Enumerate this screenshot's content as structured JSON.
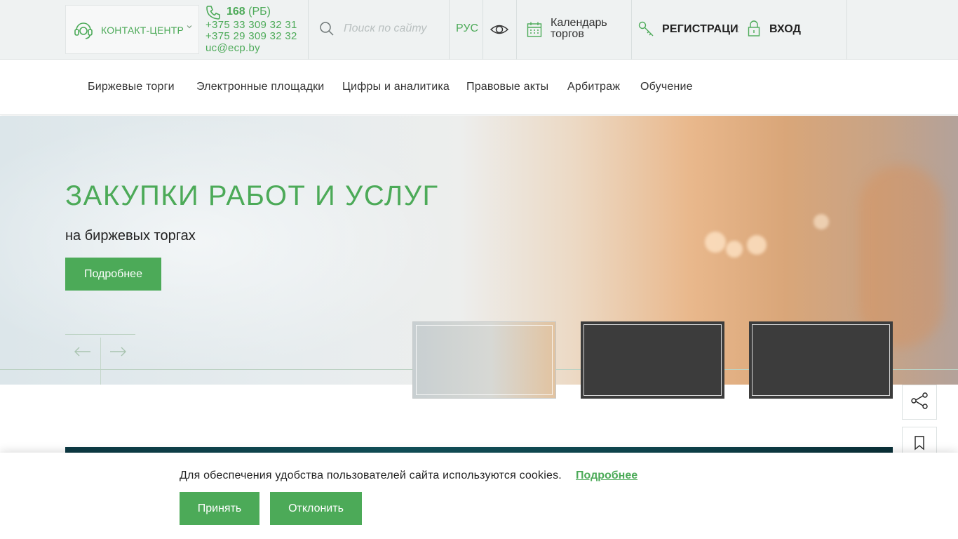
{
  "header": {
    "contact_center_label": "КОНТАКТ-ЦЕНТР",
    "phone_short": "168",
    "phone_short_suffix": "(РБ)",
    "phone_1": "+375 33 309 32 31",
    "phone_2": "+375 29 309 32 32",
    "email": "uc@ecp.by",
    "search_placeholder": "Поиск по сайту",
    "language": "РУС",
    "calendar_line1": "Календарь",
    "calendar_line2": "торгов",
    "register_label": "РЕГИСТРАЦИЯ",
    "login_label": "ВХОД"
  },
  "nav": {
    "items": [
      {
        "label": "Биржевые торги"
      },
      {
        "label": "Электронные площадки"
      },
      {
        "label": "Цифры и аналитика"
      },
      {
        "label": "Правовые акты"
      },
      {
        "label": "Арбитраж"
      },
      {
        "label": "Обучение"
      }
    ]
  },
  "hero": {
    "title": "ЗАКУПКИ РАБОТ И УСЛУГ",
    "subtitle": "на биржевых торгах",
    "button_label": "Подробнее"
  },
  "cookie": {
    "text": "Для обеспечения удобства пользователей сайта используются cookies.",
    "more_link": "Подробнее",
    "accept_label": "Принять",
    "decline_label": "Отклонить"
  },
  "colors": {
    "accent": "#4caa58",
    "topbar_bg": "#eff2f2",
    "thumb_dark": "#3c3c3c"
  }
}
